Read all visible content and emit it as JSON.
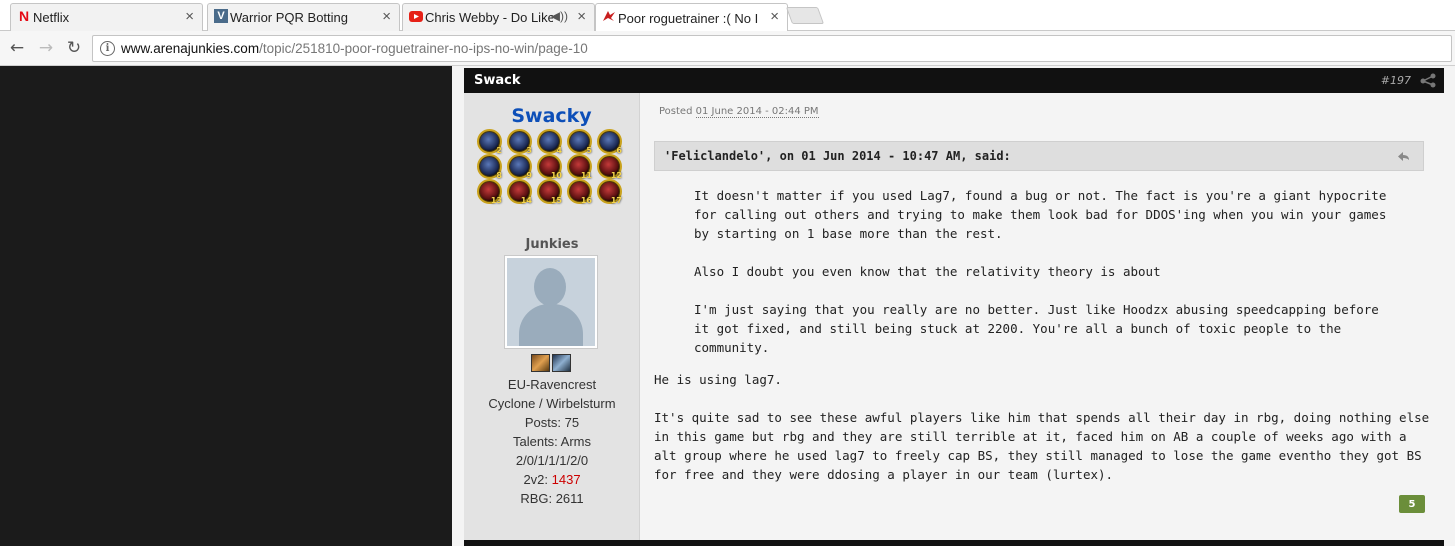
{
  "browser": {
    "tabs": [
      {
        "title": "Netflix",
        "icon": "netflix-icon",
        "color": "#e50914"
      },
      {
        "title": "Warrior PQR Botting",
        "icon": "forum-icon",
        "color": "#4a6b8a"
      },
      {
        "title": "Chris Webby - Do Like",
        "icon": "youtube-icon",
        "color": "#e62117"
      },
      {
        "title": "Poor roguetrainer :( No I",
        "icon": "arenajunkies-icon",
        "color": "#c81e1e"
      }
    ],
    "address": {
      "host": "www.arenajunkies.com",
      "path": "/topic/251810-poor-roguetrainer-no-ips-no-win/page-10"
    }
  },
  "post": {
    "author_bar": "Swack",
    "post_number": "#197",
    "author": {
      "name": "Swacky",
      "badges": [
        "2",
        "3",
        "4",
        "5",
        "6",
        "8",
        "9",
        "10",
        "11",
        "12",
        "13",
        "14",
        "15",
        "16",
        "17"
      ],
      "group": "Junkies",
      "realm": "EU-Ravencrest",
      "battlegroup": "Cyclone / Wirbelsturm",
      "posts": "Posts: 75",
      "talents": "Talents: Arms",
      "talent_spec": "2/0/1/1/1/2/0",
      "rating_label": "2v2: ",
      "rating_value": "1437",
      "rbg": "RBG: 2611"
    },
    "posted_label": "Posted",
    "posted_date": "01 June 2014 - 02:44 PM",
    "quote": {
      "header": "'Feliclandelo', on 01 Jun 2014 - 10:47 AM, said:",
      "paragraphs": [
        "It doesn't matter if you used Lag7, found a bug or not. The fact is you're a giant hypocrite for calling out others and trying to make them look bad for DDOS'ing when you win your games by starting on 1 base more than the rest.",
        "Also I doubt you even know that the relativity theory is about",
        "I'm just saying that you really are no better. Just like Hoodzx abusing speedcapping before it got fixed, and still being stuck at 2200. You're all a bunch of toxic people to the community."
      ]
    },
    "reply": [
      "He is using lag7.",
      "It's quite sad to see these awful players like him that spends all their day in rbg, doing nothing else in this game but rbg and they are still terrible at it, faced him on AB a couple of weeks ago with a alt group where he used lag7 to freely cap BS, they still managed to lose the game eventho they got BS for free and they were ddosing a player in our team (lurtex)."
    ],
    "reputation": "5"
  }
}
